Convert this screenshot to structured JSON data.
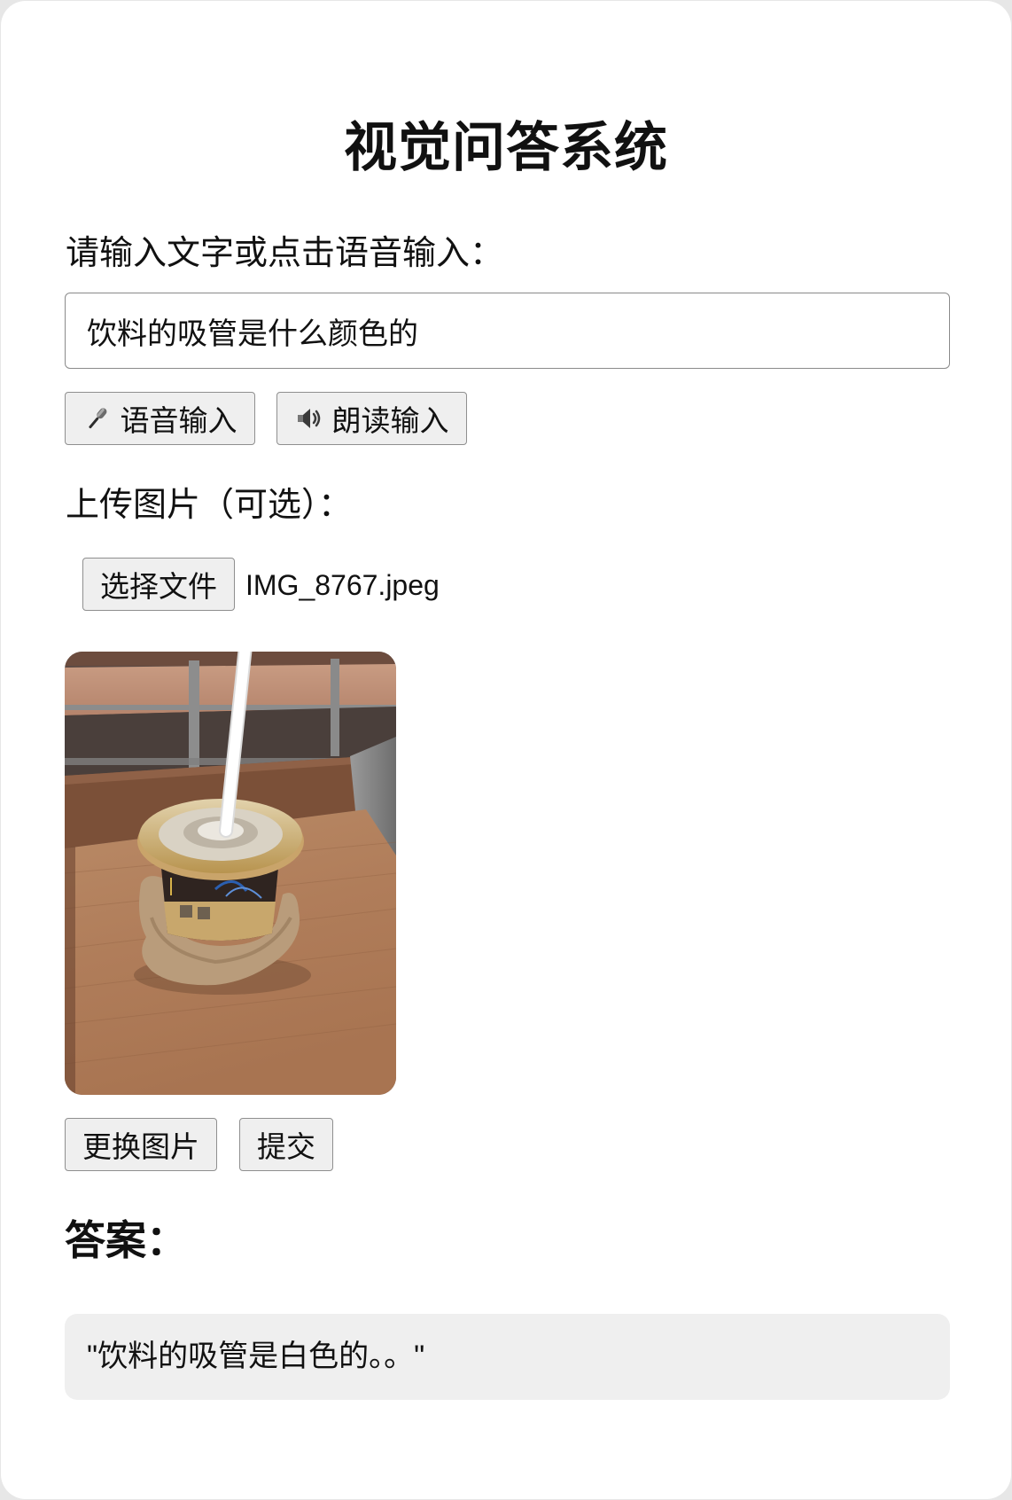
{
  "title": "视觉问答系统",
  "question": {
    "label": "请输入文字或点击语音输入：",
    "value": "饮料的吸管是什么颜色的"
  },
  "voice_buttons": [
    {
      "icon": "microphone-icon",
      "label": "语音输入"
    },
    {
      "icon": "speaker-icon",
      "label": "朗读输入"
    }
  ],
  "upload": {
    "label": "上传图片（可选）：",
    "choose_file_label": "选择文件",
    "file_name": "IMG_8767.jpeg"
  },
  "actions": {
    "change_image_label": "更换图片",
    "submit_label": "提交"
  },
  "answer": {
    "heading": "答案：",
    "text": "\"饮料的吸管是白色的。。\""
  },
  "colors": {
    "button_background": "#efefef",
    "button_border": "#8f8f8f",
    "answer_background": "#efefef",
    "page_background": "#ffffff"
  }
}
